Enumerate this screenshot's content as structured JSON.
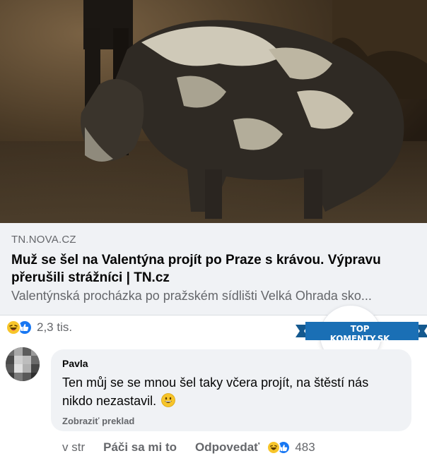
{
  "link_preview": {
    "domain": "TN.NOVA.CZ",
    "headline": "Muž se šel na Valentýna projít po Praze s krávou. Výpravu přerušili strážníci | TN.cz",
    "description": "Valentýnská procházka po pražském sídlišti Velká Ohrada sko..."
  },
  "post_reactions": {
    "icons": [
      "haha-emoji-icon",
      "like-emoji-icon"
    ],
    "count": "2,3 tis."
  },
  "badge": {
    "text": "TOP KOMENTY.SK",
    "color": "#1a6fb5"
  },
  "comment": {
    "author": "Pavla",
    "text": "Ten můj se se mnou šel taky včera projít, na štěstí nás nikdo nezastavil.",
    "emoji": "grinning-face-icon",
    "translate_label": "Zobraziť preklad",
    "time": "v str",
    "like_label": "Páči sa mi to",
    "reply_label": "Odpovedať",
    "reaction_icons": [
      "haha-emoji-icon",
      "like-emoji-icon"
    ],
    "reaction_count": "483"
  },
  "colors": {
    "secondary_text": "#65676b",
    "bubble_bg": "#f0f2f5",
    "like_blue": "#1877f2",
    "haha_yellow": "#f7c52a"
  }
}
